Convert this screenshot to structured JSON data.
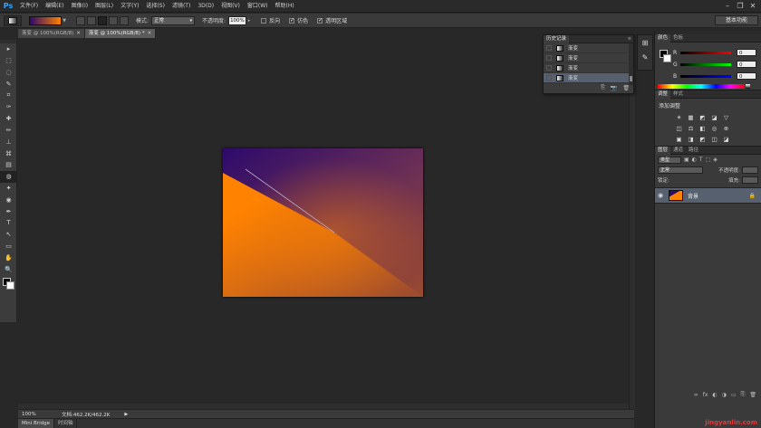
{
  "app": {
    "logo": "Ps"
  },
  "menu": [
    "文件(F)",
    "编辑(E)",
    "图像(I)",
    "图层(L)",
    "文字(Y)",
    "选择(S)",
    "滤镜(T)",
    "3D(D)",
    "视图(V)",
    "窗口(W)",
    "帮助(H)"
  ],
  "window_controls": {
    "minimize": "–",
    "restore": "❐",
    "close": "✕"
  },
  "options": {
    "mode_label": "模式:",
    "mode_value": "正常",
    "opacity_label": "不透明度:",
    "opacity_value": "100%",
    "reverse_label": "反向",
    "dither_label": "仿色",
    "transparency_label": "透明区域",
    "dither_checked": "✓",
    "transparency_checked": "✓",
    "workspace": "基本功能"
  },
  "tabs": [
    {
      "label": "渐变 @ 100%(RGB/8)",
      "close": "✕"
    },
    {
      "label": "渐变 @ 100%(RGB/8) *",
      "close": "✕"
    }
  ],
  "tools": [
    "▸",
    "⬚",
    "◌",
    "✎",
    "⌗",
    "✑",
    "✚",
    "✏",
    "⊥",
    "⌘",
    "▤",
    "◍",
    "✦",
    "◉",
    "✒",
    "T",
    "↖",
    "▭",
    "✋",
    "🔍"
  ],
  "canvas": {
    "gradient_colors": {
      "dark": "#2d0a6b",
      "mid": "#6b2f55",
      "orange": "#ff8200",
      "brown": "#9a4a30"
    }
  },
  "status": {
    "zoom": "100%",
    "doc_info": "文档:462.2K/462.2K",
    "arrow": "▶"
  },
  "bottom_tabs": [
    "Mini Bridge",
    "时间轴"
  ],
  "history": {
    "tab": "历史记录",
    "menu": "≡",
    "items": [
      {
        "label": "渐变",
        "selected": false
      },
      {
        "label": "渐变",
        "selected": false
      },
      {
        "label": "渐变",
        "selected": false
      },
      {
        "label": "渐变",
        "selected": true
      }
    ],
    "footer": [
      "⎘",
      "📷",
      "🗑"
    ]
  },
  "strip_icons": [
    "⊞",
    "✎"
  ],
  "color_panel": {
    "tabs": [
      "颜色",
      "色板"
    ],
    "channels": [
      {
        "label": "R",
        "value": "0"
      },
      {
        "label": "G",
        "value": "0"
      },
      {
        "label": "B",
        "value": "0"
      }
    ]
  },
  "adjustments": {
    "tabs": [
      "调整",
      "样式"
    ],
    "title": "添加调整",
    "icons": [
      "☀",
      "▦",
      "◩",
      "◪",
      "▽",
      "◫",
      "⚖",
      "◧",
      "◎",
      "⊕",
      "▣",
      "◨",
      "◩",
      "◫",
      "◪"
    ]
  },
  "layers": {
    "tabs": [
      "图层",
      "通道",
      "路径"
    ],
    "filter_label": "类型",
    "filter_icons": [
      "▣",
      "◐",
      "T",
      "⬚",
      "◈"
    ],
    "blend_mode": "正常",
    "opacity_label": "不透明度:",
    "lock_label": "锁定:",
    "fill_label": "填充:",
    "layer": {
      "name": "背景",
      "eye": "◉",
      "lock": "🔒"
    },
    "footer": [
      "∞",
      "fx",
      "◐",
      "◑",
      "▭",
      "⎘",
      "🗑"
    ]
  },
  "watermark": "jingyanlin.com"
}
